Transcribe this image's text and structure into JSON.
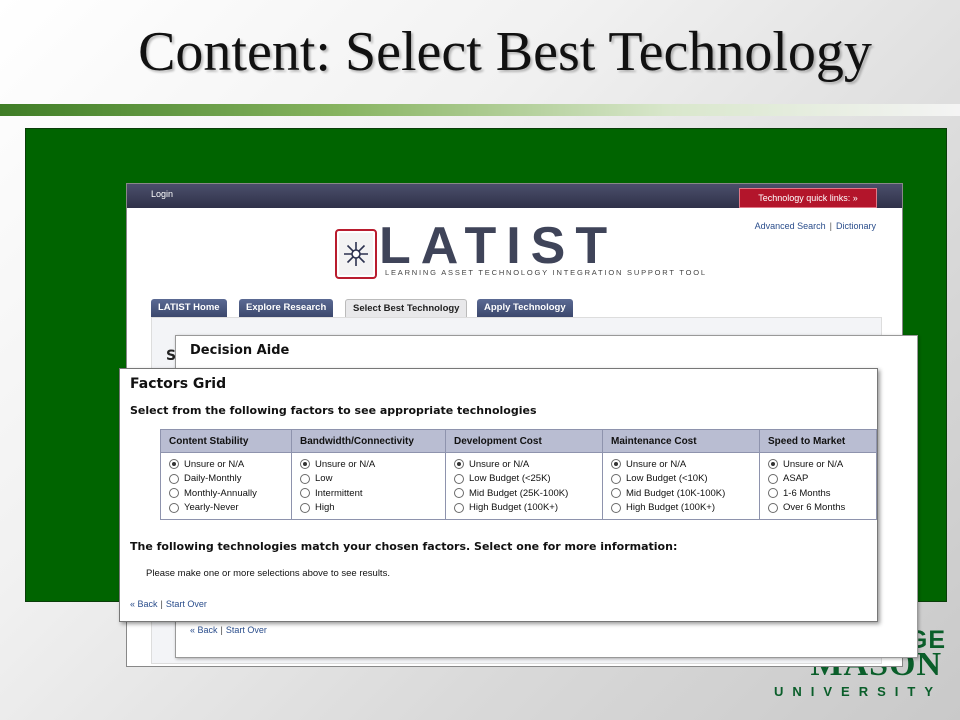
{
  "slide": {
    "title": "Content: Select Best Technology",
    "colors": {
      "panel": "#006400",
      "rule": "#4a8a2c"
    }
  },
  "gmu_logo": {
    "line1": "GE",
    "line2": "MASON",
    "line3": "UNIVERSITY"
  },
  "site": {
    "topbar": {
      "login": "Login",
      "quick_links": "Technology quick links: »"
    },
    "util": {
      "advanced_search": "Advanced Search",
      "dictionary": "Dictionary",
      "separator": "|"
    },
    "logo": {
      "word": "LATIST",
      "tagline": "LEARNING ASSET TECHNOLOGY INTEGRATION SUPPORT TOOL",
      "icon": "latist-star-icon"
    },
    "tabs": [
      {
        "label": "LATIST Home"
      },
      {
        "label": "Explore Research"
      },
      {
        "label": "Select Best Technology"
      },
      {
        "label": "Apply Technology"
      }
    ],
    "inner_heading": "S"
  },
  "decision_aide": {
    "title": "Decision Aide",
    "back": "« Back",
    "separator": "|",
    "start_over": "Start Over"
  },
  "factors": {
    "title": "Factors Grid",
    "subtitle": "Select from the following factors to see appropriate technologies",
    "columns": [
      {
        "header": "Content Stability",
        "options": [
          "Unsure or N/A",
          "Daily-Monthly",
          "Monthly-Annually",
          "Yearly-Never"
        ],
        "selected": 0
      },
      {
        "header": "Bandwidth/Connectivity",
        "options": [
          "Unsure or N/A",
          "Low",
          "Intermittent",
          "High"
        ],
        "selected": 0
      },
      {
        "header": "Development Cost",
        "options": [
          "Unsure or N/A",
          "Low Budget (<25K)",
          "Mid Budget (25K-100K)",
          "High Budget (100K+)"
        ],
        "selected": 0
      },
      {
        "header": "Maintenance Cost",
        "options": [
          "Unsure or N/A",
          "Low Budget (<10K)",
          "Mid Budget (10K-100K)",
          "High Budget (100K+)"
        ],
        "selected": 0
      },
      {
        "header": "Speed to Market",
        "options": [
          "Unsure or N/A",
          "ASAP",
          "1-6 Months",
          "Over 6 Months"
        ],
        "selected": 0
      }
    ],
    "results_heading": "The following technologies match your chosen factors. Select one for more information:",
    "results_message": "Please make one or more selections above to see results.",
    "back": "« Back",
    "separator": "|",
    "start_over": "Start Over"
  }
}
